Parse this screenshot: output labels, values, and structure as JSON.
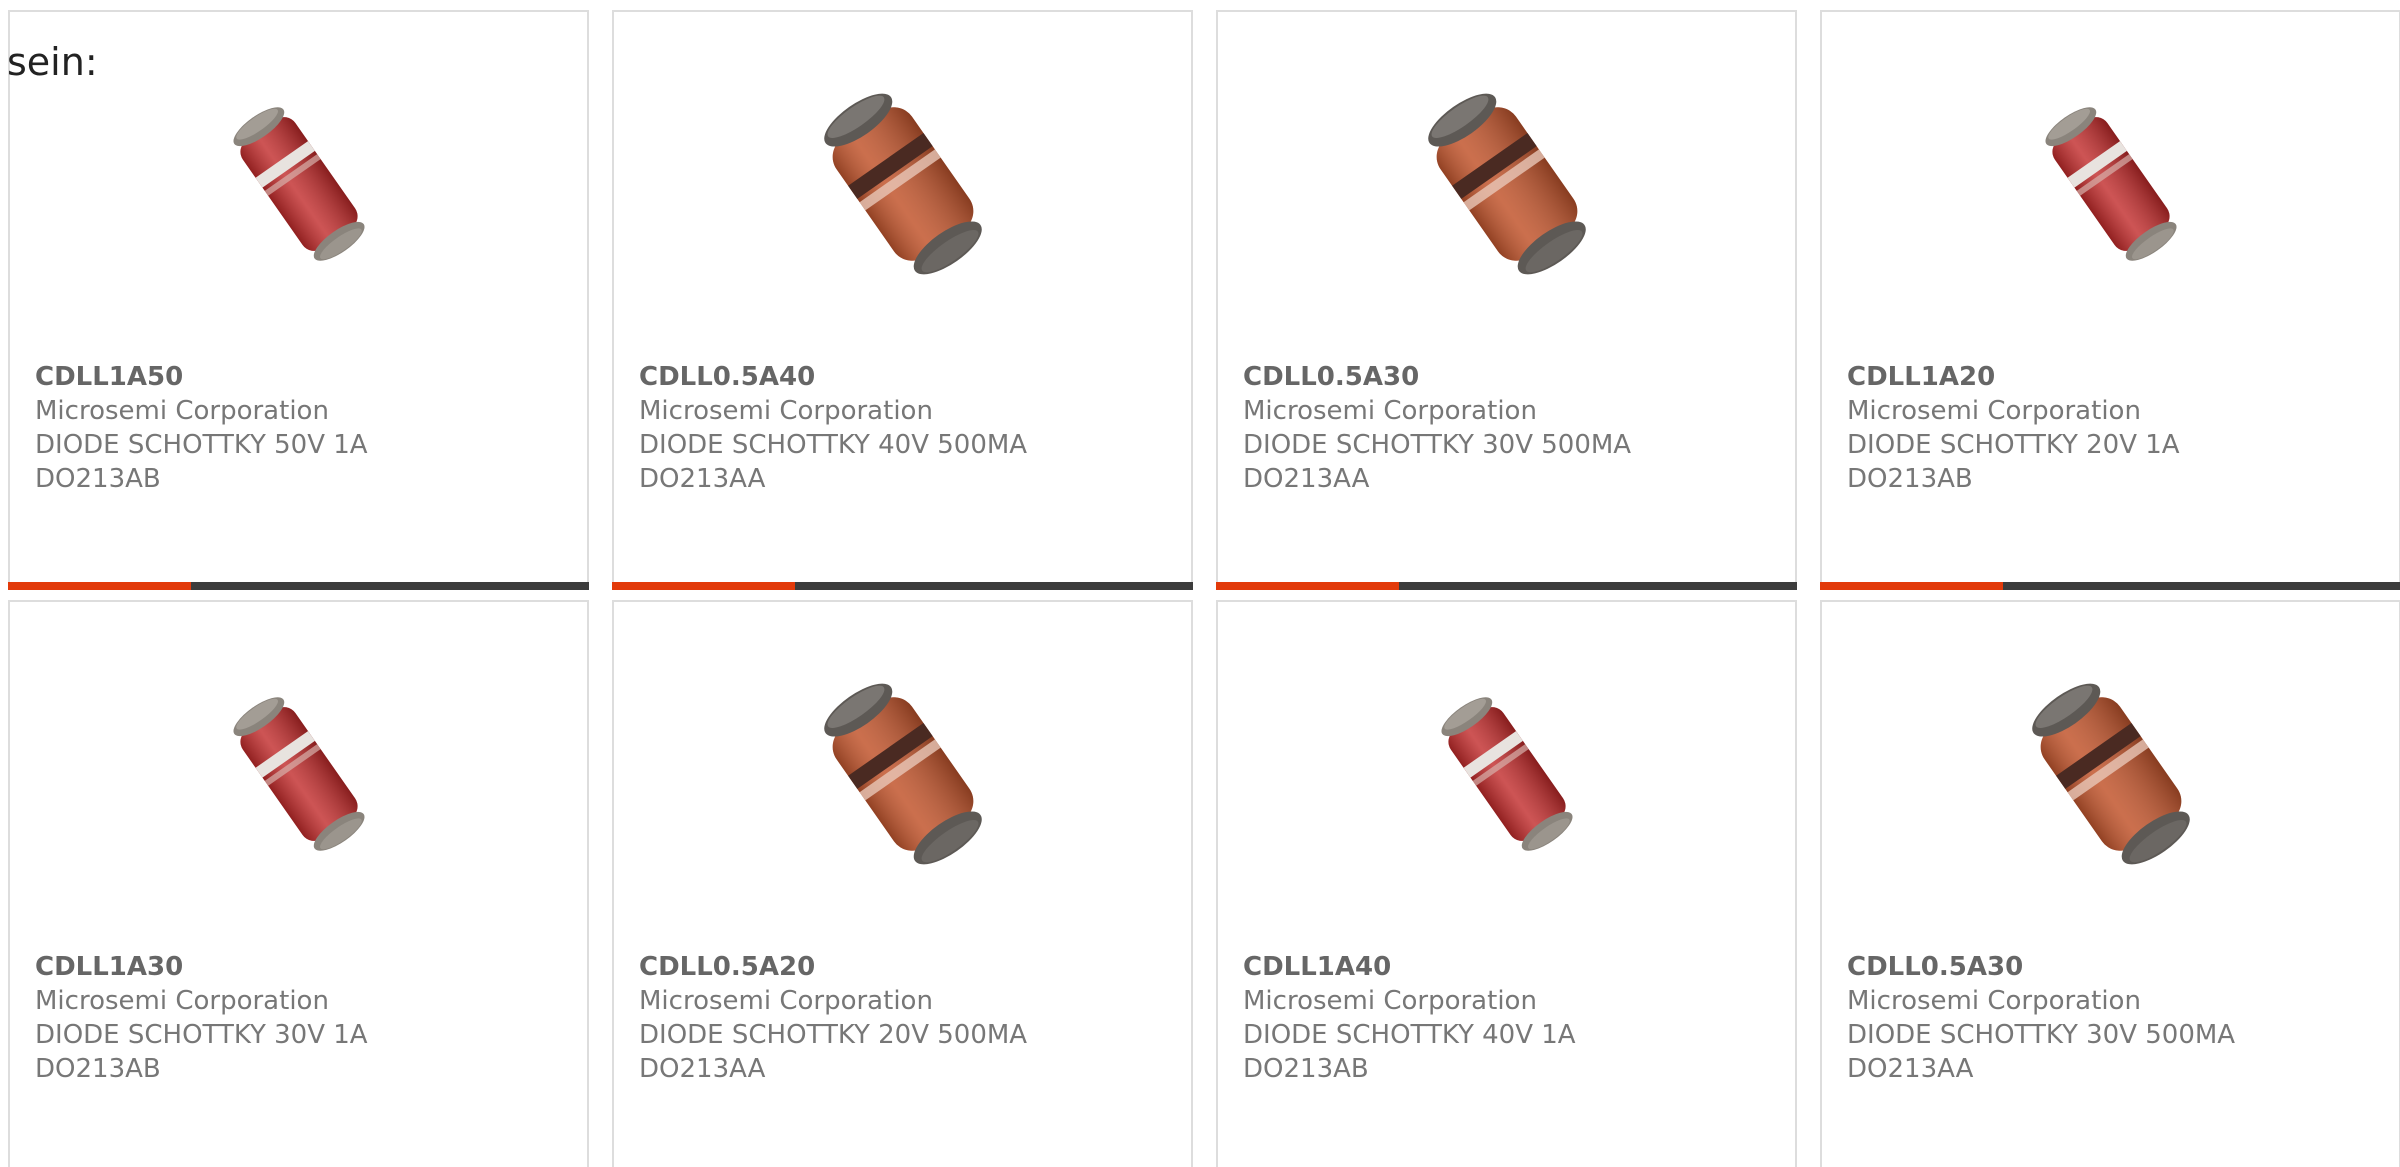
{
  "intro_text": "sein:",
  "colors": {
    "accent": "#e23a0a",
    "bar": "#3c3c3c",
    "border": "#dddddd",
    "text": "#777777",
    "title": "#666666"
  },
  "products": [
    {
      "part_number": "CDLL1A50",
      "manufacturer": "Microsemi Corporation",
      "description": "DIODE SCHOTTKY 50V 1A",
      "package": "DO213AB",
      "image": "diode-red-slim"
    },
    {
      "part_number": "CDLL0.5A40",
      "manufacturer": "Microsemi Corporation",
      "description": "DIODE SCHOTTKY 40V 500MA",
      "package": "DO213AA",
      "image": "diode-orange-wide"
    },
    {
      "part_number": "CDLL0.5A30",
      "manufacturer": "Microsemi Corporation",
      "description": "DIODE SCHOTTKY 30V 500MA",
      "package": "DO213AA",
      "image": "diode-orange-wide"
    },
    {
      "part_number": "CDLL1A20",
      "manufacturer": "Microsemi Corporation",
      "description": "DIODE SCHOTTKY 20V 1A",
      "package": "DO213AB",
      "image": "diode-red-slim"
    },
    {
      "part_number": "CDLL1A30",
      "manufacturer": "Microsemi Corporation",
      "description": "DIODE SCHOTTKY 30V 1A",
      "package": "DO213AB",
      "image": "diode-red-slim"
    },
    {
      "part_number": "CDLL0.5A20",
      "manufacturer": "Microsemi Corporation",
      "description": "DIODE SCHOTTKY 20V 500MA",
      "package": "DO213AA",
      "image": "diode-orange-wide"
    },
    {
      "part_number": "CDLL1A40",
      "manufacturer": "Microsemi Corporation",
      "description": "DIODE SCHOTTKY 40V 1A",
      "package": "DO213AB",
      "image": "diode-red-slim"
    },
    {
      "part_number": "CDLL0.5A30",
      "manufacturer": "Microsemi Corporation",
      "description": "DIODE SCHOTTKY 30V 500MA",
      "package": "DO213AA",
      "image": "diode-orange-wide"
    }
  ]
}
